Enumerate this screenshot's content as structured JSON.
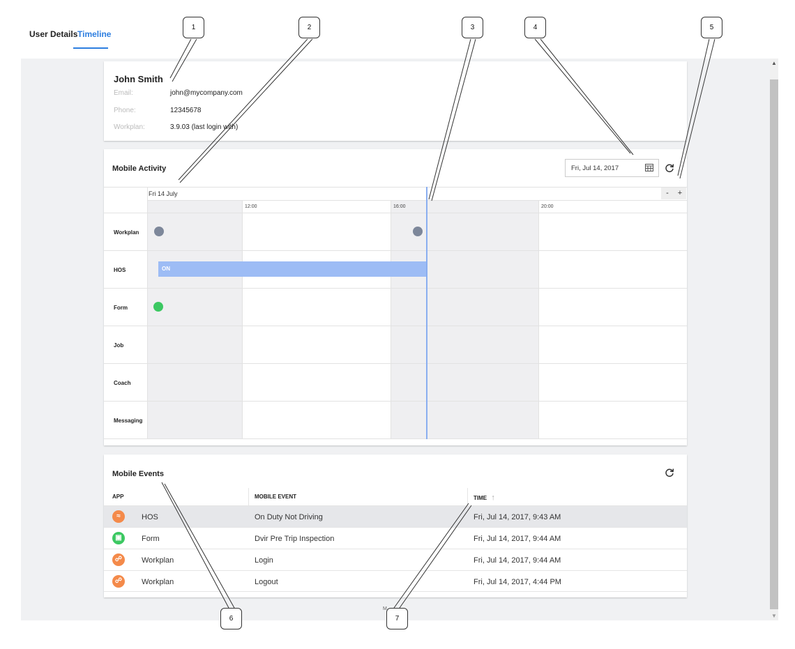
{
  "tabs": {
    "user_details": "User Details",
    "timeline": "Timeline"
  },
  "user": {
    "name": "John Smith",
    "fields": [
      {
        "label": "Email:",
        "value": "john@mycompany.com"
      },
      {
        "label": "Phone:",
        "value": "12345678"
      },
      {
        "label": "Workplan:",
        "value": "3.9.03 (last login with)"
      }
    ]
  },
  "activity": {
    "title": "Mobile Activity",
    "date_value": "Fri, Jul 14, 2017",
    "zoom_out": "-",
    "zoom_in": "+",
    "day_label": "Fri 14 July",
    "ticks": [
      "12:00",
      "16:00",
      "20:00"
    ],
    "rows": [
      "Workplan",
      "HOS",
      "Form",
      "Job",
      "Coach",
      "Messaging"
    ],
    "hos_status": "ON",
    "colors": {
      "workplan_dot": "#7d879a",
      "form_dot": "#3cc862",
      "hos_bar": "#9dbcf5",
      "now_line": "#8aaef0"
    }
  },
  "events": {
    "title": "Mobile Events",
    "columns": {
      "app": "APP",
      "event": "MOBILE EVENT",
      "time": "TIME",
      "sort_icon": "↑"
    },
    "rows": [
      {
        "app": "HOS",
        "event": "On Duty Not Driving",
        "time": "Fri, Jul 14, 2017, 9:43 AM",
        "icon": "hos-icon",
        "color": "#f48a4a"
      },
      {
        "app": "Form",
        "event": "Dvir Pre Trip Inspection",
        "time": "Fri, Jul 14, 2017, 9:44 AM",
        "icon": "form-icon",
        "color": "#3cc862"
      },
      {
        "app": "Workplan",
        "event": "Login",
        "time": "Fri, Jul 14, 2017, 9:44 AM",
        "icon": "workplan-icon",
        "color": "#f48a4a"
      },
      {
        "app": "Workplan",
        "event": "Logout",
        "time": "Fri, Jul 14, 2017, 4:44 PM",
        "icon": "workplan-icon",
        "color": "#f48a4a"
      }
    ]
  },
  "footer_text": "M",
  "callouts": [
    "1",
    "2",
    "3",
    "4",
    "5",
    "6",
    "7"
  ]
}
